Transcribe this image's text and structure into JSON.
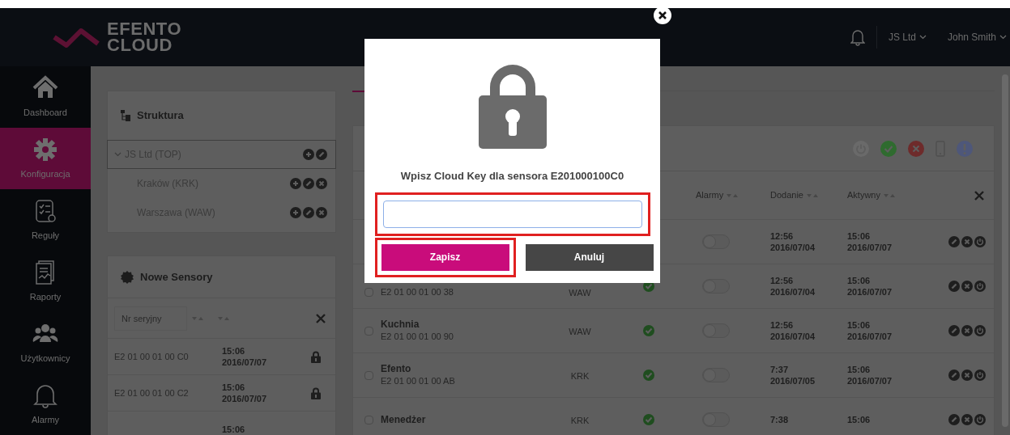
{
  "header": {
    "logo_line1": "EFENTO",
    "logo_line2": "CLOUD",
    "company": "JS Ltd",
    "user": "John Smith"
  },
  "sidebar": {
    "items": [
      {
        "label": "Dashboard",
        "kind": "home",
        "selected": false
      },
      {
        "label": "Konfiguracja",
        "kind": "gear",
        "selected": true
      },
      {
        "label": "Reguły",
        "kind": "rules",
        "selected": false
      },
      {
        "label": "Raporty",
        "kind": "report",
        "selected": false
      },
      {
        "label": "Użytkownicy",
        "kind": "users",
        "selected": false
      },
      {
        "label": "Alarmy",
        "kind": "bell",
        "selected": false
      }
    ]
  },
  "structure": {
    "title": "Struktura",
    "tree": [
      {
        "label": "JS Ltd (TOP)",
        "expanded": true,
        "selected": true,
        "deletable": false,
        "children": [
          {
            "label": "Kraków (KRK)",
            "selected": false,
            "deletable": true
          },
          {
            "label": "Warszawa (WAW)",
            "selected": false,
            "deletable": true
          }
        ]
      }
    ]
  },
  "new_sensors": {
    "title": "Nowe Sensory",
    "filter": {
      "placeholder": "Nr seryjny"
    },
    "rows": [
      {
        "serial": "E2 01 00 01 00 C0",
        "time": "15:06",
        "date": "2016/07/07",
        "locked": true
      },
      {
        "serial": "E2 01 00 01 00 C2",
        "time": "15:06",
        "date": "2016/07/07",
        "locked": true
      },
      {
        "time": "15:06"
      }
    ]
  },
  "sensors_table": {
    "columns": [
      "Alarmy",
      "Dodanie",
      "Aktywny"
    ],
    "rows": [
      {
        "alarm_on": false,
        "added_time": "12:56",
        "added_date": "2016/07/04",
        "active_time": "15:06",
        "active_date": "2016/07/07"
      },
      {
        "serial": "E2 01 00 01 00 38",
        "location": "WAW",
        "checked": false,
        "ok": true,
        "alarm_on": false,
        "added_time": "12:56",
        "added_date": "2016/07/04",
        "active_time": "15:06",
        "active_date": "2016/07/07"
      },
      {
        "name": "Kuchnia",
        "serial": "E2 01 00 01 00 90",
        "location": "WAW",
        "checked": false,
        "ok": true,
        "alarm_on": false,
        "added_time": "12:56",
        "added_date": "2016/07/04",
        "active_time": "15:06",
        "active_date": "2016/07/07"
      },
      {
        "name": "Efento",
        "serial": "E2 01 00 01 00 AB",
        "location": "KRK",
        "checked": false,
        "ok": true,
        "alarm_on": false,
        "added_time": "7:37",
        "added_date": "2016/07/05",
        "active_time": "15:06",
        "active_date": "2016/07/07"
      },
      {
        "name": "Menedżer",
        "location": "KRK",
        "checked": false,
        "ok": true,
        "alarm_on": false,
        "added_time": "7:38",
        "active_time": "15:06"
      }
    ]
  },
  "modal": {
    "title": "Wpisz Cloud Key dla sensora E201000100C0",
    "input": {
      "highlighted": true
    },
    "buttons": [
      {
        "label": "Zapisz",
        "kind": "primary",
        "highlighted": true
      },
      {
        "label": "Anuluj",
        "kind": "secondary",
        "highlighted": false
      }
    ]
  }
}
